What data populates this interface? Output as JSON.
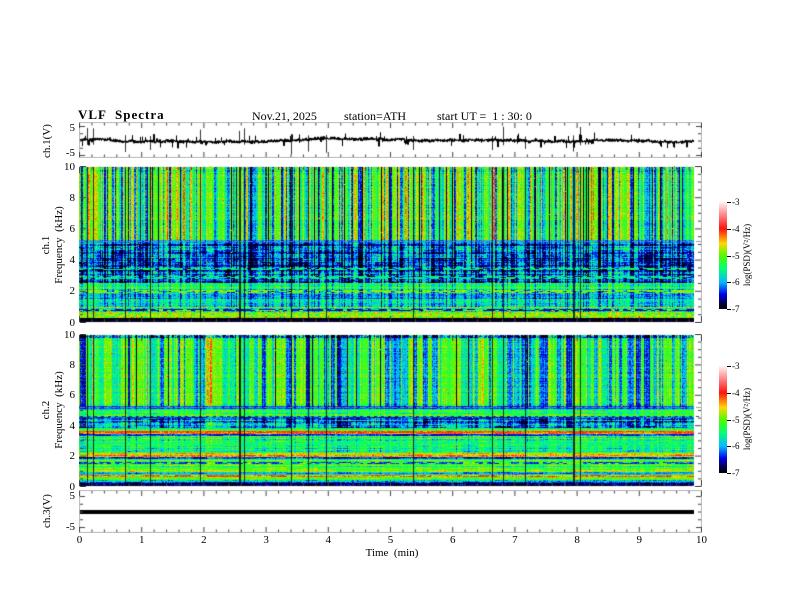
{
  "header": {
    "title": "VLF  Spectra",
    "date": "Nov.21, 2025",
    "station": "station=ATH",
    "start_ut": "start UT =  1 : 30: 0"
  },
  "time_axis": {
    "label": "Time  (min)",
    "tick_labels": [
      "0",
      "1",
      "2",
      "3",
      "4",
      "5",
      "6",
      "7",
      "8",
      "9",
      "10"
    ],
    "tick_values": [
      0,
      1,
      2,
      3,
      4,
      5,
      6,
      7,
      8,
      9,
      10
    ],
    "minor_divisions": 5,
    "range": [
      0,
      10
    ]
  },
  "panels": {
    "ch1_wave": {
      "ylabel": "ch.1(V)",
      "ytick_labels": [
        "5",
        "-5"
      ],
      "ytick_values": [
        5,
        -5
      ],
      "ylim": [
        -6.2,
        6.2
      ]
    },
    "ch1_spec": {
      "ylabel_lines": [
        "ch.1",
        "Frequency  (kHz)"
      ],
      "ytick_labels": [
        "0",
        "2",
        "4",
        "6",
        "8",
        "10"
      ],
      "ytick_values": [
        0,
        2,
        4,
        6,
        8,
        10
      ],
      "minor_step": 0.5,
      "ylim": [
        0,
        10
      ]
    },
    "ch2_spec": {
      "ylabel_lines": [
        "ch.2",
        "Frequency  (kHz)"
      ],
      "ytick_labels": [
        "0",
        "2",
        "4",
        "6",
        "8",
        "10"
      ],
      "ytick_values": [
        0,
        2,
        4,
        6,
        8,
        10
      ],
      "minor_step": 0.5,
      "ylim": [
        0,
        10
      ]
    },
    "ch3_wave": {
      "ylabel": "ch.3(V)",
      "ytick_labels": [
        "5",
        "-5"
      ],
      "ytick_values": [
        5,
        -5
      ],
      "ylim": [
        -6.2,
        6.2
      ]
    }
  },
  "colorbar": {
    "label": "log(PSD)(V²/Hz)",
    "tick_labels": [
      "-3",
      "-4",
      "-5",
      "-6",
      "-7"
    ],
    "tick_values": [
      -3,
      -4,
      -5,
      -6,
      -7
    ],
    "zlim": [
      -7,
      -3
    ],
    "stops": [
      [
        -7,
        "#000000"
      ],
      [
        -6.8,
        "#030341"
      ],
      [
        -6.45,
        "#0000e8"
      ],
      [
        -6.0,
        "#07b8ff"
      ],
      [
        -5.5,
        "#01ff75"
      ],
      [
        -5.0,
        "#51fb00"
      ],
      [
        -4.55,
        "#ffd605"
      ],
      [
        -4.0,
        "#fc130f"
      ],
      [
        -3.45,
        "#ff8e92"
      ],
      [
        -3.0,
        "#fff4f4"
      ]
    ]
  },
  "chart_data": {
    "type": "spectrogram",
    "x_range_min": [
      0,
      10
    ],
    "event_count": 16,
    "events_description": "impulsive broadband events: dark full-height vertical lines in both spectrograms, spikes in ch.1 waveform",
    "panels": [
      {
        "id": "ch1_wave",
        "type": "line",
        "ylabel": "ch.1(V)",
        "ylim_V": [
          -5,
          5
        ],
        "description": "noisy voltage trace centered on 0 V with impulsive spikes to ±5 V",
        "baseline_V": 0,
        "noise_amp_V": 0.58,
        "spike_prob": 0.035,
        "seed": 11
      },
      {
        "id": "ch1_spec",
        "type": "spectrogram",
        "freq_range_kHz": [
          0,
          10
        ],
        "psd_range_log": [
          -7,
          -3
        ],
        "bands": [
          [
            0,
            0.3,
            -6.9,
            0.25,
            0.1
          ],
          [
            0.3,
            0.55,
            -5.05,
            0.95,
            0.3
          ],
          [
            0.55,
            1.0,
            -5.15,
            0.85,
            0.45
          ],
          [
            1.0,
            2.15,
            -5.75,
            0.5,
            0.25
          ],
          [
            2.15,
            2.55,
            -5.2,
            0.4,
            0.2
          ],
          [
            2.55,
            5.15,
            -6.1,
            0.55,
            0.3
          ],
          [
            5.15,
            5.3,
            -6.0,
            0.3,
            0.05
          ],
          [
            5.3,
            9.7,
            -5.0,
            0.45,
            0.12
          ],
          [
            9.7,
            10,
            -5.1,
            0.6,
            0.15
          ]
        ],
        "streak_weights": [
          [
            0,
            0.3,
            0.05
          ],
          [
            0.3,
            1.0,
            0.18
          ],
          [
            1.0,
            2.55,
            0.35
          ],
          [
            2.55,
            5.15,
            0.55
          ],
          [
            5.15,
            5.3,
            0.3
          ],
          [
            5.3,
            10,
            1.0
          ]
        ],
        "hlines": [
          [
            3.45,
            -5.55
          ],
          [
            2.9,
            -5.6
          ],
          [
            2.0,
            -4.9
          ],
          [
            0.82,
            -6.6
          ],
          [
            0.45,
            -4.8
          ]
        ],
        "dashed_gray_line_kHz": 5.22,
        "block_band": [
          2.55,
          5.15
        ],
        "hdash_amp": 0.3,
        "streaks": {
          "density": 0.5,
          "maxw": 2,
          "blue_frac": 0.55,
          "yellow_frac": 0.24
        },
        "seed": 21
      },
      {
        "id": "ch2_spec",
        "type": "spectrogram",
        "freq_range_kHz": [
          0,
          10
        ],
        "psd_range_log": [
          -7,
          -3
        ],
        "bands": [
          [
            0,
            0.25,
            -6.85,
            0.75,
            0.1
          ],
          [
            0.25,
            0.45,
            -6.15,
            0.55,
            0.3
          ],
          [
            0.45,
            0.6,
            -5.15,
            0.4,
            0.2
          ],
          [
            0.6,
            0.75,
            -4.45,
            0.4,
            0.25
          ],
          [
            0.75,
            0.95,
            -5.85,
            0.4,
            0.2
          ],
          [
            0.95,
            1.1,
            -4.7,
            0.35,
            0.2
          ],
          [
            1.1,
            1.8,
            -5.2,
            0.45,
            0.35
          ],
          [
            1.8,
            1.95,
            -6.3,
            0.3,
            0.15
          ],
          [
            1.95,
            2.2,
            -4.6,
            0.4,
            0.3
          ],
          [
            2.2,
            3.35,
            -5.25,
            0.45,
            0.35
          ],
          [
            3.35,
            3.45,
            -6.2,
            0.3,
            0.1
          ],
          [
            3.45,
            3.65,
            -4.2,
            0.35,
            0.25
          ],
          [
            3.65,
            3.9,
            -5.3,
            0.45,
            0.25
          ],
          [
            3.9,
            4.45,
            -5.95,
            0.55,
            0.3
          ],
          [
            4.45,
            4.6,
            -6.35,
            0.35,
            0.2
          ],
          [
            4.6,
            5.15,
            -5.25,
            0.45,
            0.25
          ],
          [
            5.15,
            5.35,
            -6.2,
            0.3,
            0.05
          ],
          [
            5.35,
            9.85,
            -5.05,
            0.45,
            0.12
          ],
          [
            9.85,
            10,
            -5.8,
            1.1,
            0.2
          ]
        ],
        "streak_weights": [
          [
            0,
            0.45,
            0.08
          ],
          [
            0.45,
            2.2,
            0.16
          ],
          [
            2.2,
            3.35,
            0.28
          ],
          [
            3.35,
            3.9,
            0.15
          ],
          [
            3.9,
            4.45,
            0.5
          ],
          [
            4.45,
            5.35,
            0.2
          ],
          [
            5.35,
            10,
            1.0
          ]
        ],
        "hlines": [
          [
            1.55,
            -6.3
          ],
          [
            2.85,
            -5.5
          ]
        ],
        "dashed_gray_line_kHz": 5.25,
        "dashed_dark_line_kHz": 4.65,
        "block_band": [
          3.9,
          4.45
        ],
        "hdash_amp": 0.5,
        "streaks": {
          "density": 0.3,
          "maxw": 6,
          "blue_frac": 0.72,
          "yellow_frac": 0.14
        },
        "seed": 42
      },
      {
        "id": "ch3_wave",
        "type": "line",
        "ylabel": "ch.3(V)",
        "ylim_V": [
          -5,
          5
        ],
        "description": "flat thick line at 0 V (no signal)",
        "baseline_V": 0,
        "noise_amp_V": 0,
        "seed": 3
      }
    ]
  }
}
